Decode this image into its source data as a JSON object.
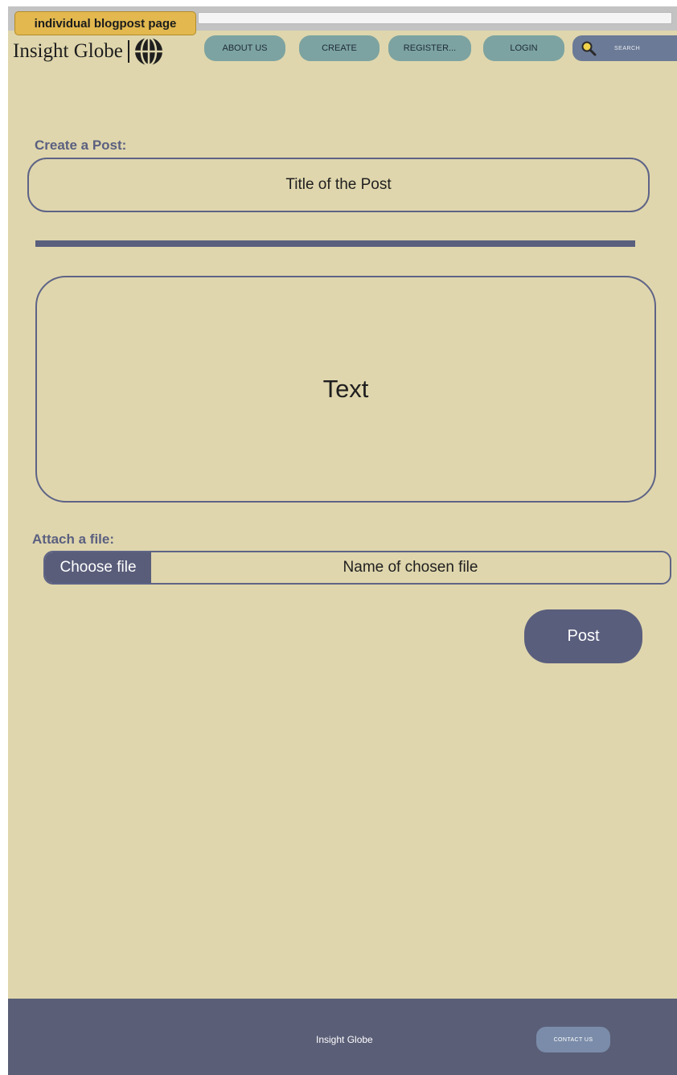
{
  "annotation": {
    "page_tag": "individual blogpost page"
  },
  "brand": {
    "name": "Insight Globe",
    "logo_icon": "globe-icon"
  },
  "nav": {
    "items": [
      {
        "label": "ABOUT US"
      },
      {
        "label": "CREATE"
      },
      {
        "label": "REGISTER..."
      },
      {
        "label": "LOGIN"
      }
    ],
    "search_label": "SEARCH"
  },
  "form": {
    "create_label": "Create a Post:",
    "title_placeholder": "Title of the Post",
    "text_placeholder": "Text",
    "attach_label": "Attach a file:",
    "choose_file_label": "Choose file",
    "file_name_placeholder": "Name of chosen file",
    "post_button_label": "Post"
  },
  "footer": {
    "brand": "Insight Globe",
    "contact_label": "CONTACT US"
  },
  "colors": {
    "page_background": "#dfd6ad",
    "nav_button": "#7ca3a1",
    "accent_dark": "#5a5e7d",
    "search_box": "#6b7a96",
    "tag_yellow": "#e2b84f"
  }
}
